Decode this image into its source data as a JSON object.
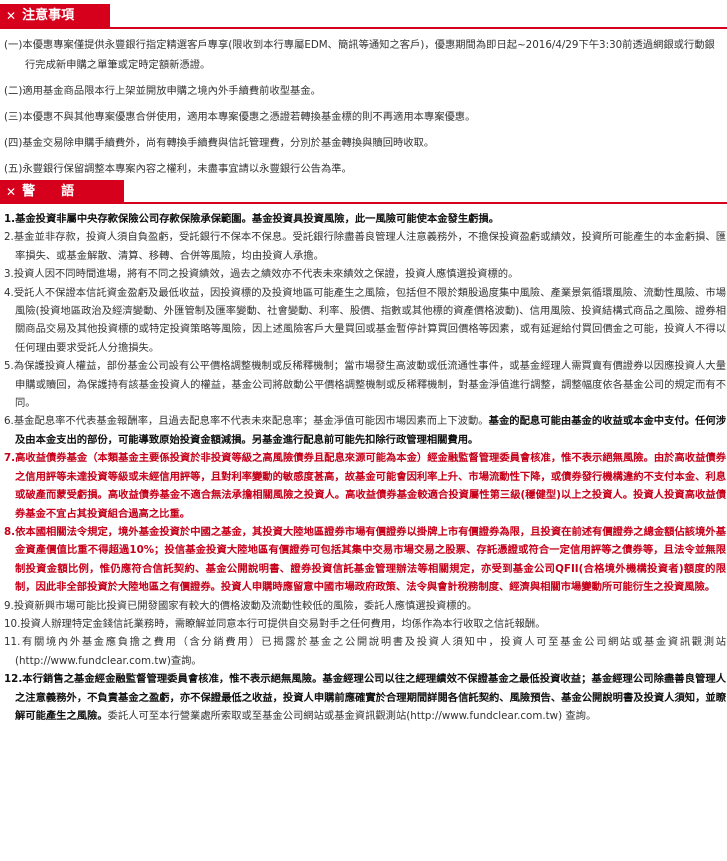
{
  "notice": {
    "header": "注意事項",
    "items": [
      "(一)本優惠專案僅提供永豐銀行指定精選客戶專享(限收到本行專屬EDM、簡訊等通知之客戶)，優惠期間為即日起~2016/4/29下午3:30前透過網銀或行動銀行完成新申購之單筆或定時定額新憑證。",
      "(二)適用基金商品限本行上架並開放申購之境內外手續費前收型基金。",
      "(三)本優惠不與其他專案優惠合併使用，適用本專案優惠之憑證若轉換基金標的則不再適用本專案優惠。",
      "(四)基金交易除申購手續費外，尚有轉換手續費與信託管理費，分別於基金轉換與贖回時收取。",
      "(五)永豐銀行保留調整本專案內容之權利，未盡事宜請以永豐銀行公告為準。"
    ]
  },
  "warning": {
    "header": "警語",
    "w1": "1.基金投資非屬中央存款保險公司存款保險承保範圍。基金投資具投資風險，此一風險可能使本金發生虧損。",
    "w2": "2.基金並非存款，投資人須自負盈虧，受託銀行不保本不保息。受託銀行除盡善良管理人注意義務外，不擔保投資盈虧或績效，投資所可能產生的本金虧損、匯率損失、或基金解散、清算、移轉、合併等風險，均由投資人承擔。",
    "w3": "3.投資人因不同時間進場，將有不同之投資績效，過去之績效亦不代表未來績效之保證，投資人應慎選投資標的。",
    "w4": "4.受託人不保證本信託資金盈虧及最低收益，因投資標的及投資地區可能產生之風險，包括但不限於類股過度集中風險、產業景氣循環風險、流動性風險、市場風險(投資地區政治及經濟變動、外匯管制及匯率變動、社會變動、利率、股價、指數或其他標的資產價格波動)、信用風險、投資結構式商品之風險、證券相關商品交易及其他投資標的或特定投資策略等風險，因上述風險客戶大量買回或基金暫停計算買回價格等因素，或有延遲給付買回價金之可能，投資人不得以任何理由要求受託人分擔損失。",
    "w5": "5.為保護投資人權益，部份基金公司設有公平價格調整機制或反稀釋機制；當市場發生高波動或低流通性事件，或基金經理人需買賣有價證券以因應投資人大量申購或贖回，為保護持有該基金投資人的權益，基金公司將啟動公平價格調整機制或反稀釋機制，對基金淨值進行調整，調整幅度依各基金公司的規定而有不同。",
    "w6a": "6.基金配息率不代表基金報酬率，且過去配息率不代表未來配息率；基金淨值可能因市場因素而上下波動。",
    "w6b": "基金的配息可能由基金的收益或本金中支付。任何涉及由本金支出的部份，可能導致原始投資金額減損。另基金進行配息前可能先扣除行政管理相關費用。",
    "w7": "7.高收益債券基金（本類基金主要係投資於非投資等級之高風險債券且配息來源可能為本金）經金融監督管理委員會核准，惟不表示絕無風險。由於高收益債券之信用評等未達投資等級或未經信用評等，且對利率變動的敏感度甚高，故基金可能會因利率上升、市場流動性下降，或債券發行機構違約不支付本金、利息或破產而蒙受虧損。高收益債券基金不適合無法承擔相關風險之投資人。高收益債券基金較適合投資屬性第三級(穩健型)以上之投資人。投資人投資高收益債券基金不宜占其投資組合過高之比重。",
    "w8": "8.依本國相關法令規定，境外基金投資於中國之基金，其投資大陸地區證券市場有價證券以掛牌上市有價證券為限，且投資在前述有價證券之總金額佔該境外基金資產價值比重不得超過10%；投信基金投資大陸地區有價證券可包括其集中交易市場交易之股票、存託憑證或符合一定信用評等之債券等，且法令並無限制投資金額比例，惟仍應符合信託契約、基金公開說明書、證券投資信託基金管理辦法等相關規定，亦受到基金公司QFII(合格境外機構投資者)額度的限制，因此非全部投資於大陸地區之有價證券。投資人申購時應留意中國市場政府政策、法令與會計稅務制度、經濟與相關市場變動所可能衍生之投資風險。",
    "w9": "9.投資新興市場可能比投資已開發國家有較大的價格波動及流動性較低的風險，委託人應慎選投資標的。",
    "w10": "10.投資人辦理特定金錢信託業務時，需瞭解並同意本行可提供自交易對手之任何費用，均係作為本行收取之信託報酬。",
    "w11": "11.有關境內外基金應負擔之費用（含分銷費用）已揭露於基金之公開說明書及投資人須知中，投資人可至基金公司網站或基金資訊觀測站(http://www.fundclear.com.tw)查詢。",
    "w12a": "12.本行銷售之基金經金融監督管理委員會核准，惟不表示絕無風險。基金經理公司以往之經理績效不保證基金之最低投資收益；基金經理公司除盡善良管理人之注意義務外，不負責基金之盈虧，亦不保證最低之收益，投資人申購前應確實於合理期間詳閱各信託契約、風險預告、基金公開說明書及投資人須知，並瞭解可能產生之風險。",
    "w12b": "委託人可至本行營業處所索取或至基金公司網站或基金資訊觀測站(http://www.fundclear.com.tw) 查詢。"
  }
}
